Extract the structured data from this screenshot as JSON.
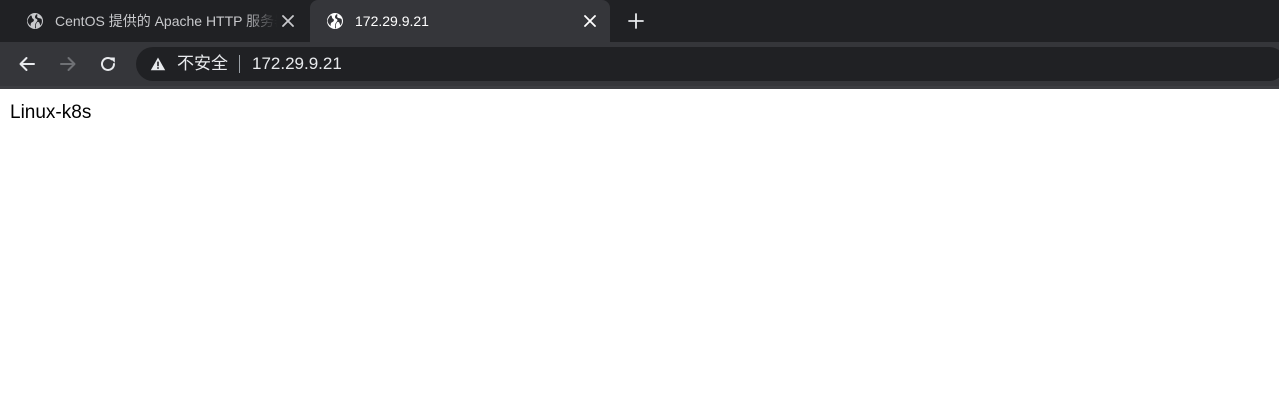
{
  "tabs": [
    {
      "title": "CentOS 提供的 Apache HTTP 服务器测试页",
      "active": false,
      "favicon": "globe-icon"
    },
    {
      "title": "172.29.9.21",
      "active": true,
      "favicon": "globe-icon"
    }
  ],
  "toolbar": {
    "security_label": "不安全",
    "url": "172.29.9.21"
  },
  "page": {
    "body_text": "Linux-k8s"
  },
  "colors": {
    "tabstrip_bg": "#202124",
    "active_tab_bg": "#35363a",
    "omnibox_bg": "#202124",
    "page_bg": "#ffffff"
  },
  "icons": [
    "globe-icon",
    "close-icon",
    "plus-icon",
    "back-arrow-icon",
    "forward-arrow-icon",
    "reload-icon",
    "warning-triangle-icon"
  ]
}
